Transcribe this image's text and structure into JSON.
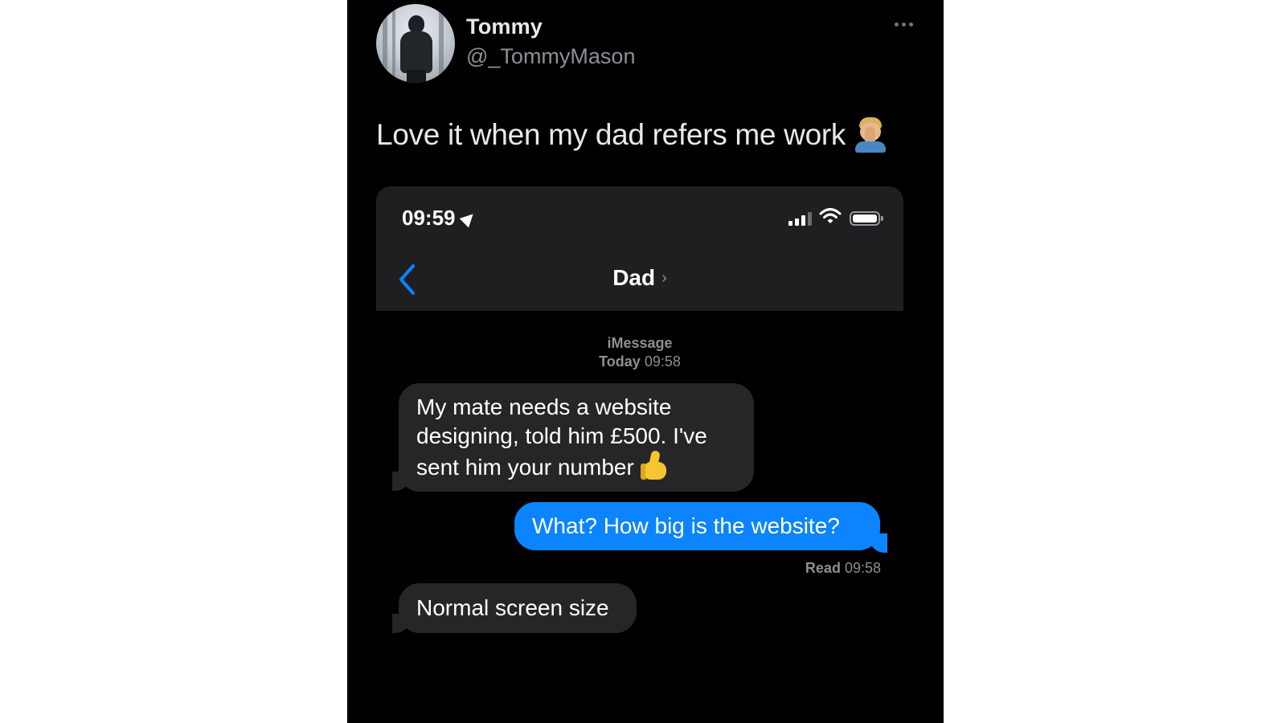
{
  "tweet": {
    "author_name": "Tommy",
    "author_handle": "@_TommyMason",
    "text": "Love it when my dad refers me work",
    "emoji_icon": "facepalm-icon",
    "more_icon": "more-icon"
  },
  "screenshot": {
    "status_bar": {
      "time": "09:59",
      "icons": [
        "location-arrow-icon",
        "signal-icon",
        "wifi-icon",
        "battery-icon"
      ]
    },
    "nav": {
      "back_icon": "chevron-left-icon",
      "contact": "Dad",
      "contact_chevron": "›"
    },
    "thread_meta": {
      "service": "iMessage",
      "day": "Today",
      "time": "09:58"
    },
    "messages": [
      {
        "direction": "incoming",
        "text": "My mate needs a website designing, told him £500. I've sent him your number",
        "emoji_icon": "thumbs-up-icon"
      },
      {
        "direction": "outgoing",
        "text": "What? How big is the website?"
      },
      {
        "direction": "incoming",
        "text": "Normal screen size"
      }
    ],
    "read_receipt": {
      "label": "Read",
      "time": "09:58"
    }
  },
  "colors": {
    "background": "#000000",
    "imessage_blue": "#0b84fe",
    "incoming_bubble": "#262629",
    "header_bar": "#1f1f21"
  }
}
